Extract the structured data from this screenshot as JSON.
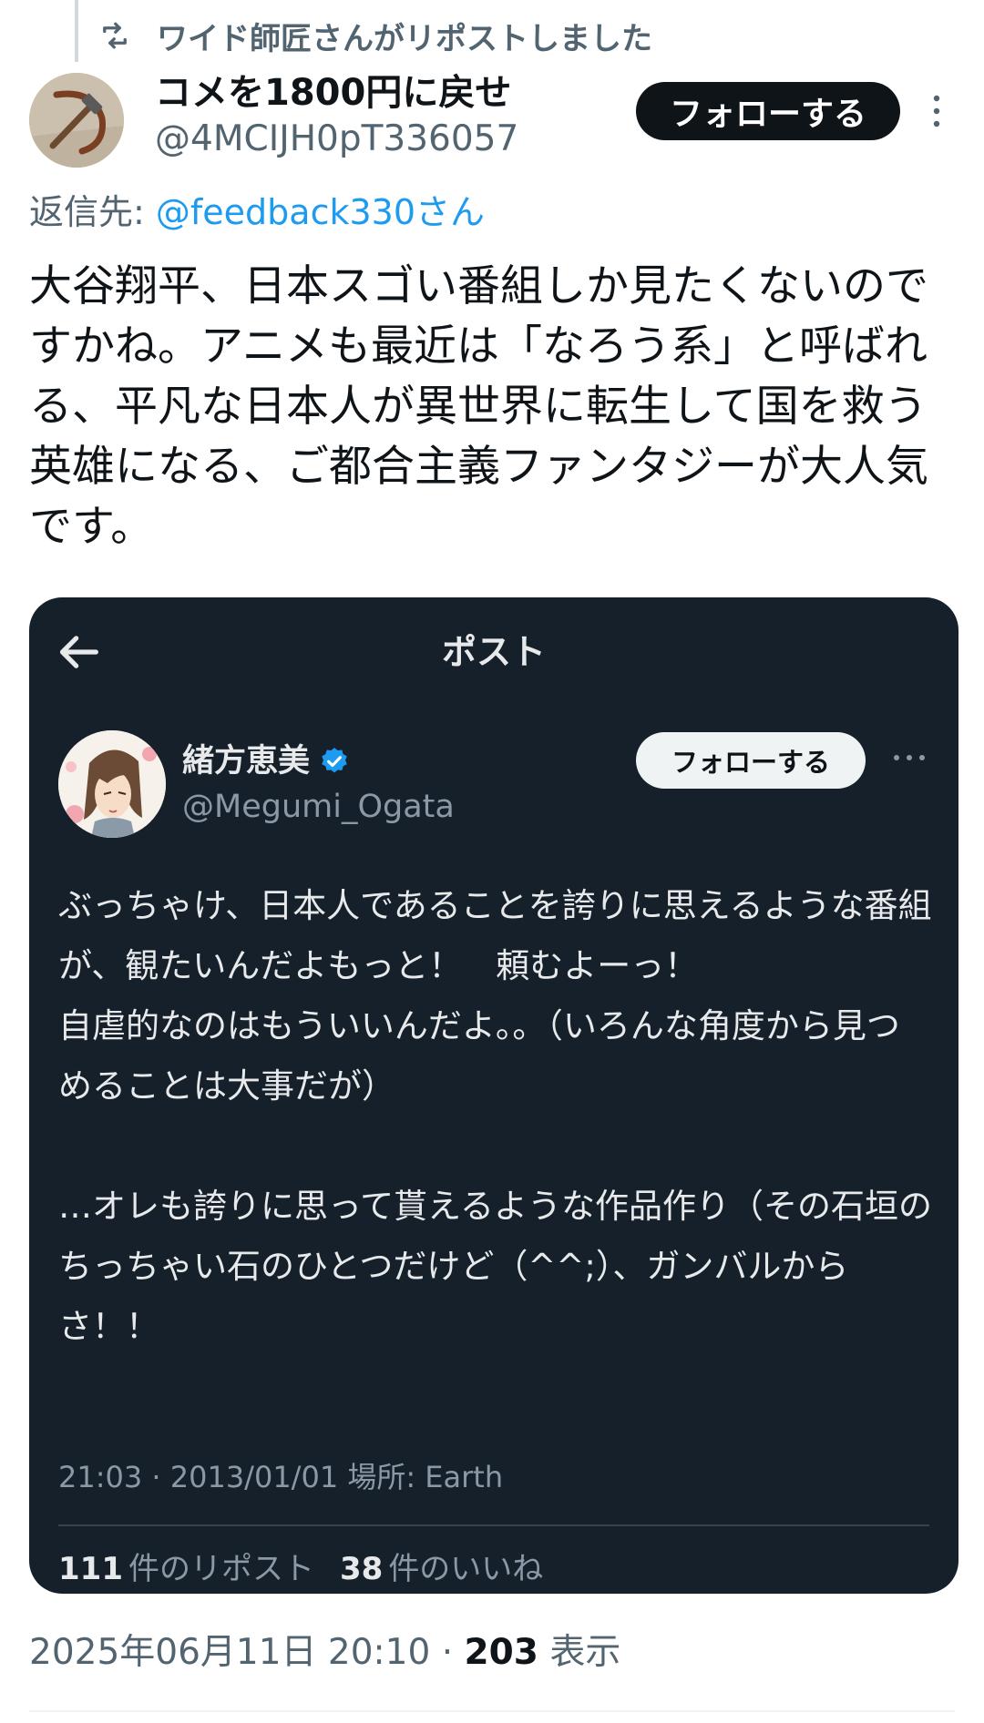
{
  "repost": {
    "label": "ワイド師匠さんがリポストしました",
    "icon": "repost-icon"
  },
  "tweet": {
    "author_name": "コメを1800円に戻せ",
    "author_handle": "@4MCIJH0pT336057",
    "follow_label": "フォローする",
    "reply_prefix": "返信先:",
    "reply_mention": "@feedback330さん",
    "text": "大谷翔平、日本スゴい番組しか見たくないのですかね。アニメも最近は「なろう系」と呼ばれる、平凡な日本人が異世界に転生して国を救う英雄になる、ご都合主義ファンタジーが大人気です。",
    "timestamp": "2025年06月11日 20:10",
    "separator": " · ",
    "views_count": "203",
    "views_label": "表示"
  },
  "quoted": {
    "header_title": "ポスト",
    "author_name": "緒方恵美",
    "author_handle": "@Megumi_Ogata",
    "follow_label": "フォローする",
    "verified": true,
    "text": "ぶっちゃけ、日本人であることを誇りに思えるような番組が、観たいんだよもっと！　頼むよーっ！\n自虐的なのはもういいんだよ。。（いろんな角度から見つめることは大事だが）\n\n…オレも誇りに思って貰えるような作品作り（その石垣のちっちゃい石のひとつだけど（^^;）、ガンバルからさ！！",
    "meta": "21:03 · 2013/01/01 場所: Earth",
    "reposts_count": "111",
    "reposts_label": "件のリポスト",
    "likes_count": "38",
    "likes_label": "件のいいね"
  },
  "colors": {
    "accent": "#1d9bf0",
    "card_bg": "#15202b",
    "muted": "#536471"
  }
}
